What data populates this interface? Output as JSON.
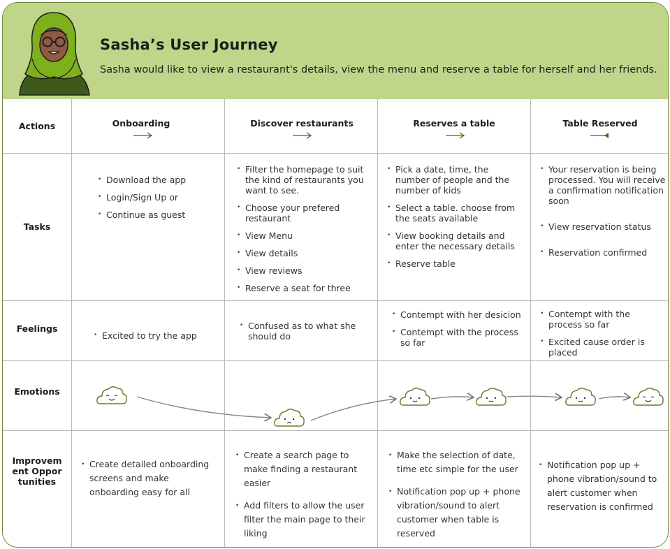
{
  "header": {
    "title": "Sasha’s User Journey",
    "subtitle": "Sasha would like to view a restaurant's details, view the menu and reserve a table for herself and her friends."
  },
  "rows": {
    "actions": "Actions",
    "tasks": "Tasks",
    "feelings": "Feelings",
    "emotions": "Emotions",
    "improvement": "Improvement Opportunities"
  },
  "stages": [
    {
      "label": "Onboarding"
    },
    {
      "label": "Discover restaurants"
    },
    {
      "label": "Reserves a table"
    },
    {
      "label": "Table Reserved"
    }
  ],
  "tasks": [
    [
      "Download the app",
      "Login/Sign Up or",
      "Continue as guest"
    ],
    [
      "Filter the homepage to suit the kind of restaurants you want to see.",
      "Choose your prefered restaurant",
      "View Menu",
      "View details",
      "View reviews",
      "Reserve a seat for three"
    ],
    [
      "Pick a date, time, the number of people and the number of kids",
      "Select a table. choose from the seats available",
      "View booking details and enter the necessary details",
      "Reserve table"
    ],
    [
      "Your reservation is being processed. You will receive a confirmation notification soon",
      "View reservation status",
      "Reservation confirmed"
    ]
  ],
  "feelings": [
    [
      "Excited to try the app"
    ],
    [
      "Confused as to what she should do"
    ],
    [
      "Contempt with her desicion",
      "Contempt with the process so far"
    ],
    [
      "Contempt with the process so far",
      "Excited cause order is placed"
    ]
  ],
  "improvements": [
    [
      "Create detailed onboarding screens and make onboarding easy for all"
    ],
    [
      "Create a search page to make finding a restaurant easier",
      "Add filters to allow the user filter the main page to their liking"
    ],
    [
      "Make the selection of date, time etc simple for the user",
      "Notification pop up + phone vibration/sound to alert customer when table is reserved"
    ],
    [
      "Notification pop up + phone vibration/sound to alert customer when reservation is confirmed"
    ]
  ],
  "emotions": [
    "happy",
    "neutral",
    "sad",
    "neutral",
    "neutral",
    "neutral",
    "happy"
  ],
  "colors": {
    "header_bg": "#bfd58a",
    "border": "#6f8a3a",
    "accent_dark": "#4f6417",
    "cloud_stroke": "#6b7a2c",
    "hijab": "#7db01c",
    "skin": "#8e5a44"
  }
}
